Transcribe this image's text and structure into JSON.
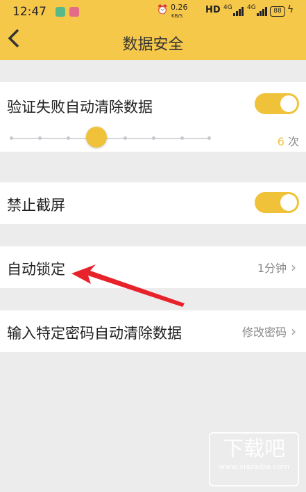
{
  "status_bar": {
    "time": "12:47",
    "speed": "0.26",
    "speed_unit": "KB/S",
    "hd": "HD",
    "net1": "4G",
    "net2": "4G",
    "battery": "88"
  },
  "header": {
    "back_icon": "chevron-left-icon",
    "title": "数据安全"
  },
  "settings": {
    "auto_clear": {
      "label": "验证失败自动清除数据",
      "toggle_on": true,
      "slider_count": "6",
      "slider_unit": "次"
    },
    "screenshot_block": {
      "label": "禁止截屏",
      "toggle_on": true
    },
    "auto_lock": {
      "label": "自动锁定",
      "value": "1分钟"
    },
    "password_clear": {
      "label": "输入特定密码自动清除数据",
      "action": "修改密码"
    }
  },
  "watermark": {
    "text": "下载吧",
    "sub": "www.xiazaiba.com"
  },
  "colors": {
    "accent": "#f6c84a",
    "toggle": "#f0c23a",
    "arrow": "#e8222b"
  }
}
